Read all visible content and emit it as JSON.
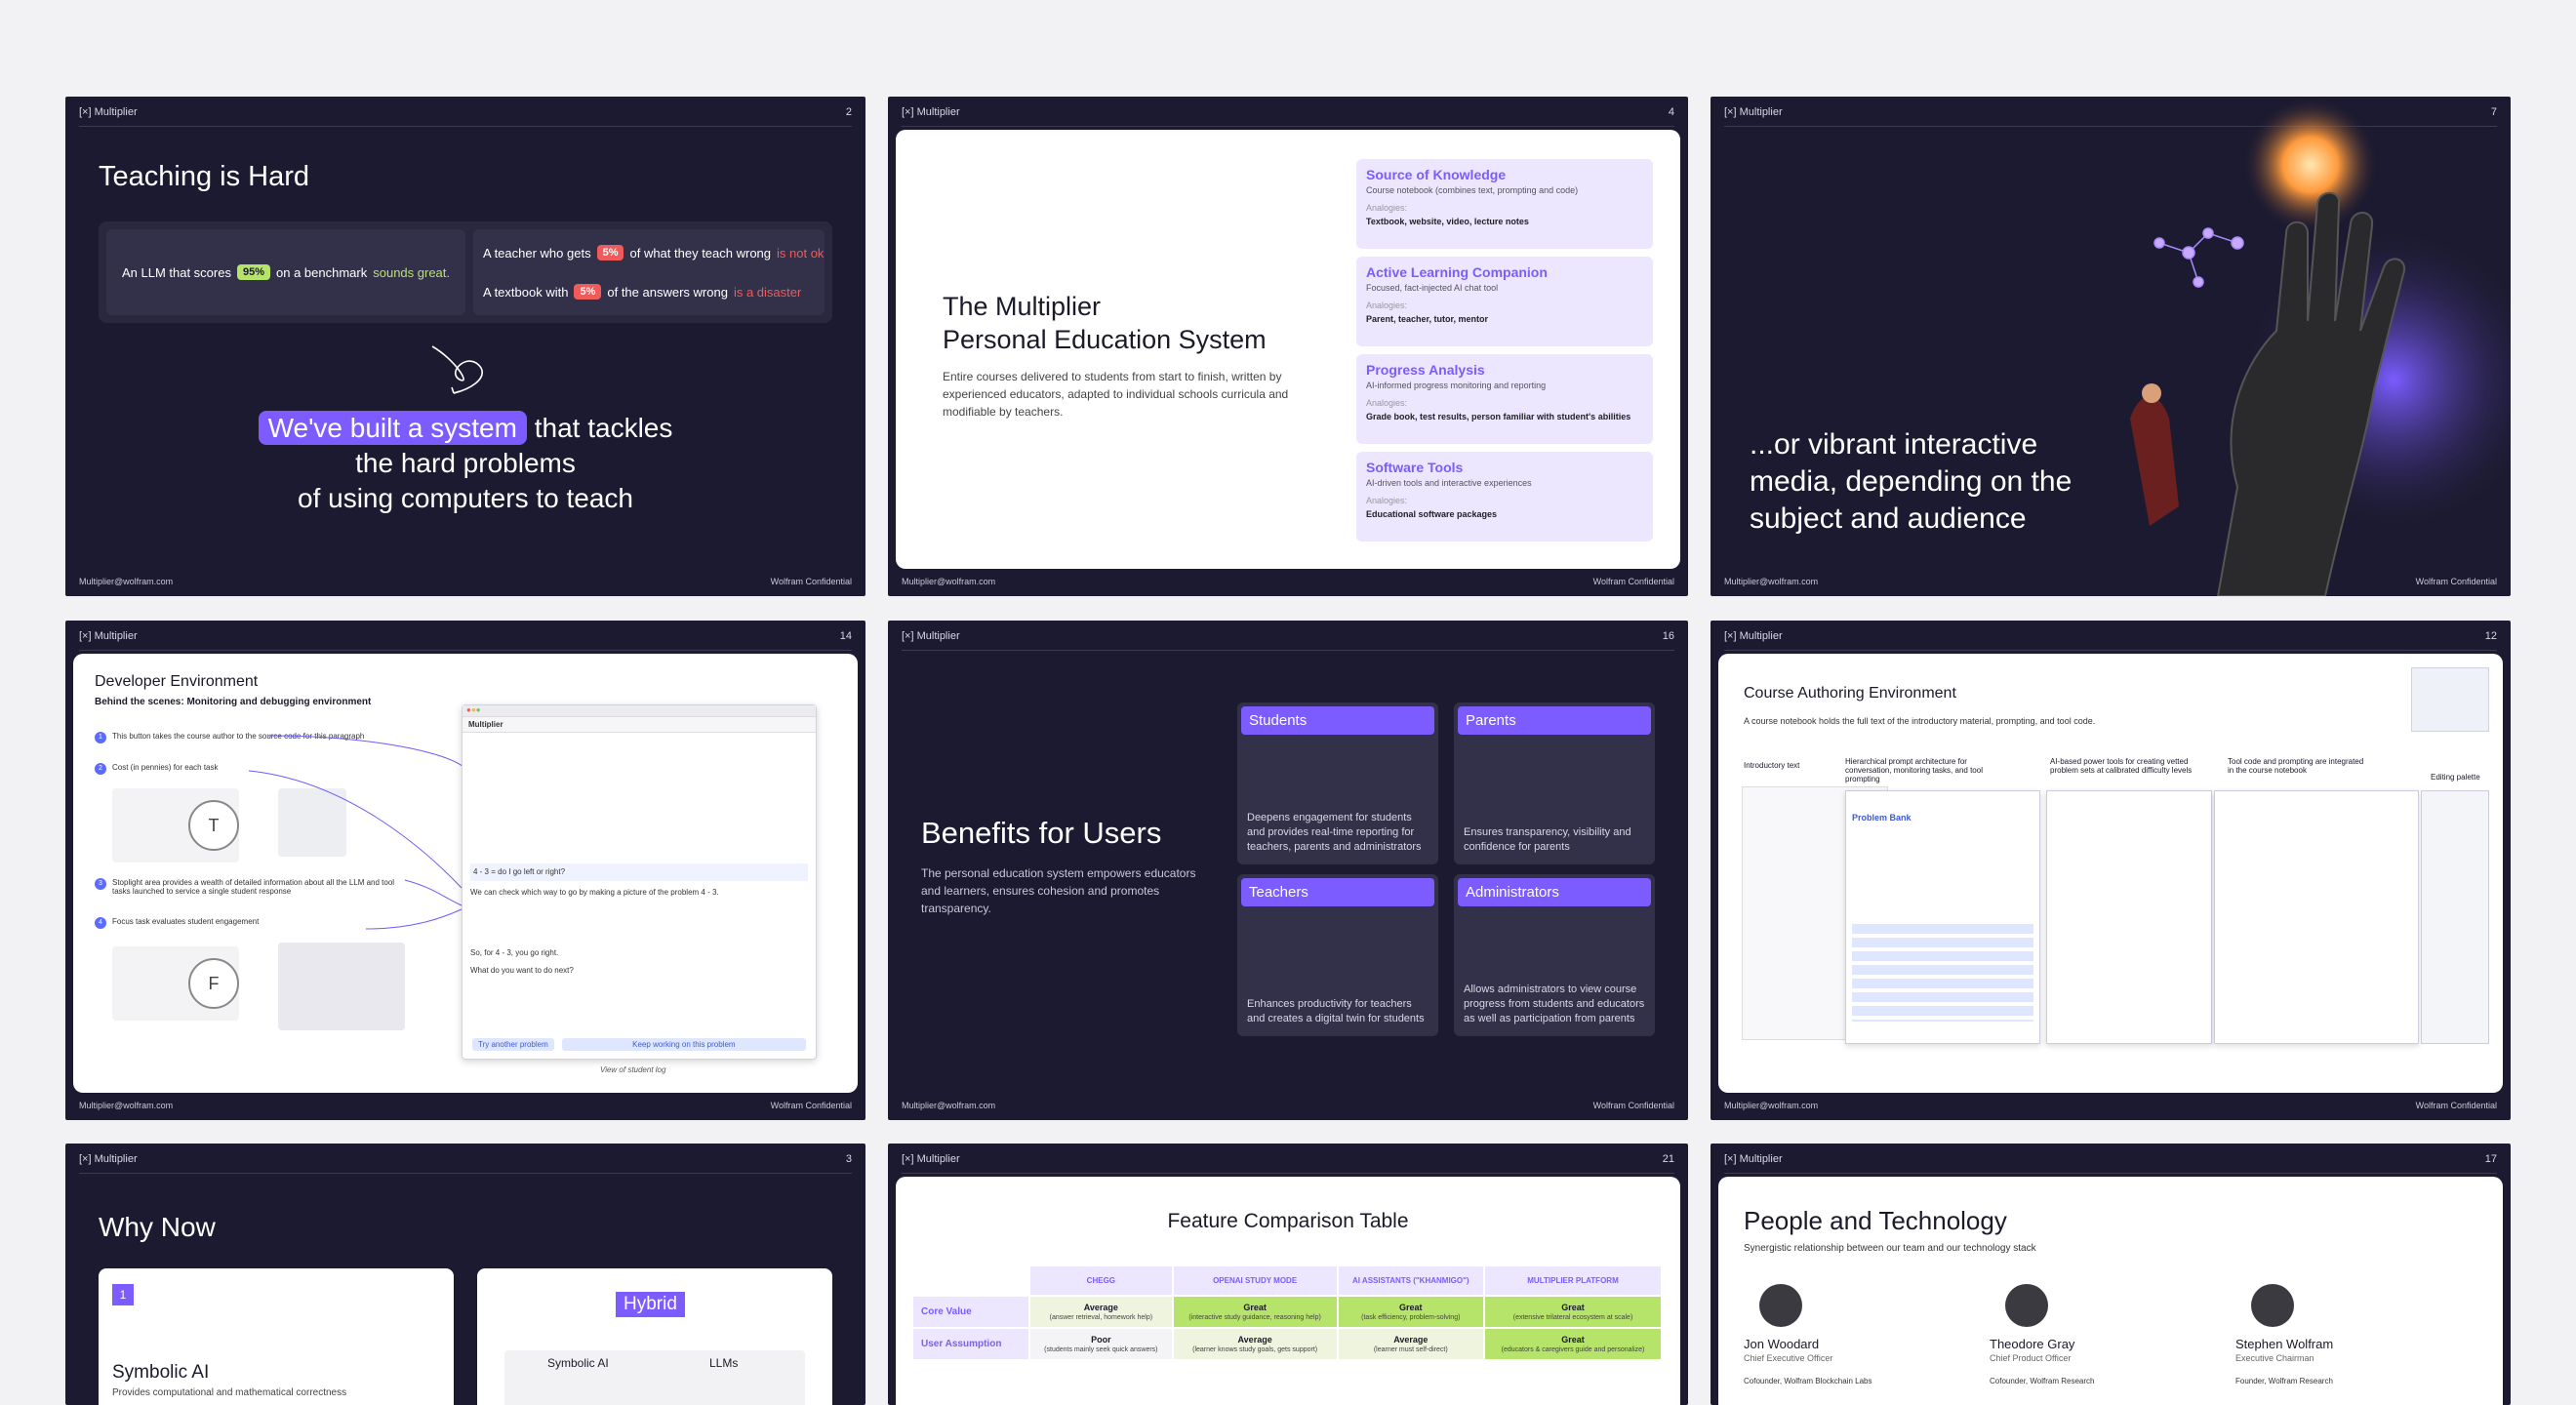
{
  "brand": "Multiplier",
  "footer_left": "Multiplier@wolfram.com",
  "footer_right": "Wolfram Confidential",
  "slides": {
    "s1": {
      "page": "2",
      "title": "Teaching is Hard",
      "llm_pre": "An LLM that scores",
      "llm_pct": "95%",
      "llm_mid": "on a benchmark",
      "llm_post": "sounds great.",
      "teacher_pre": "A teacher who gets",
      "teacher_pct": "5%",
      "teacher_mid": "of what they teach wrong",
      "teacher_post": "is not ok",
      "textbook_pre": "A textbook with",
      "textbook_pct": "5%",
      "textbook_mid": "of the answers wrong",
      "textbook_post": "is a disaster",
      "hl": "We've built a system",
      "l1": "that tackles",
      "l2": "the hard problems",
      "l3": "of using computers to teach"
    },
    "s2": {
      "page": "4",
      "title1": "The Multiplier",
      "title2": "Personal Education System",
      "desc": "Entire courses delivered to students from start to finish, written by experienced educators, adapted to individual schools curricula and modifiable by teachers.",
      "analogies_label": "Analogies:",
      "boxes": [
        {
          "title": "Source of Knowledge",
          "sub": "Course notebook (combines text, prompting and code)",
          "ana": "Textbook, website, video, lecture notes"
        },
        {
          "title": "Active Learning Companion",
          "sub": "Focused, fact-injected AI chat tool",
          "ana": "Parent, teacher, tutor, mentor"
        },
        {
          "title": "Progress Analysis",
          "sub": "AI-informed progress monitoring and reporting",
          "ana": "Grade book, test results, person familiar with student's abilities"
        },
        {
          "title": "Software Tools",
          "sub": "AI-driven tools and interactive experiences",
          "ana": "Educational software packages"
        }
      ]
    },
    "s3": {
      "page": "7",
      "l1": "...or vibrant interactive",
      "l2": "media, depending on the",
      "l3": "subject and audience"
    },
    "s4": {
      "page": "14",
      "title": "Developer Environment",
      "sub": "Behind the scenes: Monitoring and debugging environment",
      "notes": [
        "This button takes the course author to the source code for this paragraph",
        "Cost (in pennies) for each task",
        "Stoplight area provides a wealth of detailed information about all the LLM and tool tasks launched to service a single student response",
        "Focus task evaluates student engagement"
      ],
      "caption": "View of student log",
      "q1": "4 - 3 = do I go left or right?",
      "q2": "We can check which way to go by making a picture of the problem 4 - 3.",
      "q3": "So, for 4 - 3, you go right.",
      "q4": "What do you want to do next?",
      "btn1": "Try another problem",
      "btn2": "Keep working on this problem",
      "letter1": "T",
      "letter2": "F"
    },
    "s5": {
      "page": "16",
      "title": "Benefits for Users",
      "desc": "The personal education system empowers educators and learners, ensures cohesion and promotes transparency.",
      "cards": [
        {
          "title": "Students",
          "body": "Deepens engagement for students and provides real-time reporting for teachers, parents and administrators"
        },
        {
          "title": "Parents",
          "body": "Ensures transparency, visibility and confidence for parents"
        },
        {
          "title": "Teachers",
          "body": "Enhances productivity for teachers and creates a digital twin for students"
        },
        {
          "title": "Administrators",
          "body": "Allows administrators to view course progress from students and educators as well as participation from parents"
        }
      ]
    },
    "s6": {
      "page": "12",
      "title": "Course Authoring Environment",
      "sub": "A course notebook holds the full text of the introductory material, prompting, and tool code.",
      "labels": [
        "Introductory text",
        "Hierarchical prompt architecture for conversation, monitoring tasks, and tool prompting",
        "AI-based power tools for creating vetted problem sets at calibrated difficulty levels",
        "Tool code and prompting are integrated in the course notebook",
        "Editing palette"
      ],
      "pb": "Problem Bank"
    },
    "s7": {
      "page": "3",
      "title": "Why Now",
      "num": "1",
      "c1": "Symbolic AI",
      "c1sub": "Provides computational and mathematical correctness",
      "hybrid": "Hybrid",
      "col1": "Symbolic AI",
      "col2": "LLMs"
    },
    "s8": {
      "page": "21",
      "title": "Feature Comparison Table",
      "cols": [
        "CHEGG",
        "OPENAI STUDY MODE",
        "AI ASSISTANTS (\"KHANMIGO\")",
        "MULTIPLIER PLATFORM"
      ],
      "rows": [
        {
          "label": "Core Value",
          "cells": [
            {
              "v": "Average",
              "d": "(answer retrieval, homework help)"
            },
            {
              "v": "Great",
              "d": "(interactive study guidance, reasoning help)"
            },
            {
              "v": "Great",
              "d": "(task efficiency, problem-solving)"
            },
            {
              "v": "Great",
              "d": "(extensive trilateral ecosystem at scale)"
            }
          ]
        },
        {
          "label": "User Assumption",
          "cells": [
            {
              "v": "Poor",
              "d": "(students mainly seek quick answers)"
            },
            {
              "v": "Average",
              "d": "(learner knows study goals, gets support)"
            },
            {
              "v": "Average",
              "d": "(learner must self-direct)"
            },
            {
              "v": "Great",
              "d": "(educators & caregivers guide and personalize)"
            }
          ]
        }
      ]
    },
    "s9": {
      "page": "17",
      "title": "People and Technology",
      "sub": "Synergistic relationship between our team and our technology stack",
      "people": [
        {
          "name": "Jon Woodard",
          "role": "Chief Executive Officer",
          "note": "Cofounder, Wolfram Blockchain Labs"
        },
        {
          "name": "Theodore Gray",
          "role": "Chief Product Officer",
          "note": "Cofounder, Wolfram Research"
        },
        {
          "name": "Stephen Wolfram",
          "role": "Executive Chairman",
          "note": "Founder, Wolfram Research"
        }
      ]
    }
  },
  "colors": {
    "accent": "#7c5cff",
    "dark": "#1c1a30",
    "green": "#b6e36a",
    "red": "#ef5a5a"
  }
}
